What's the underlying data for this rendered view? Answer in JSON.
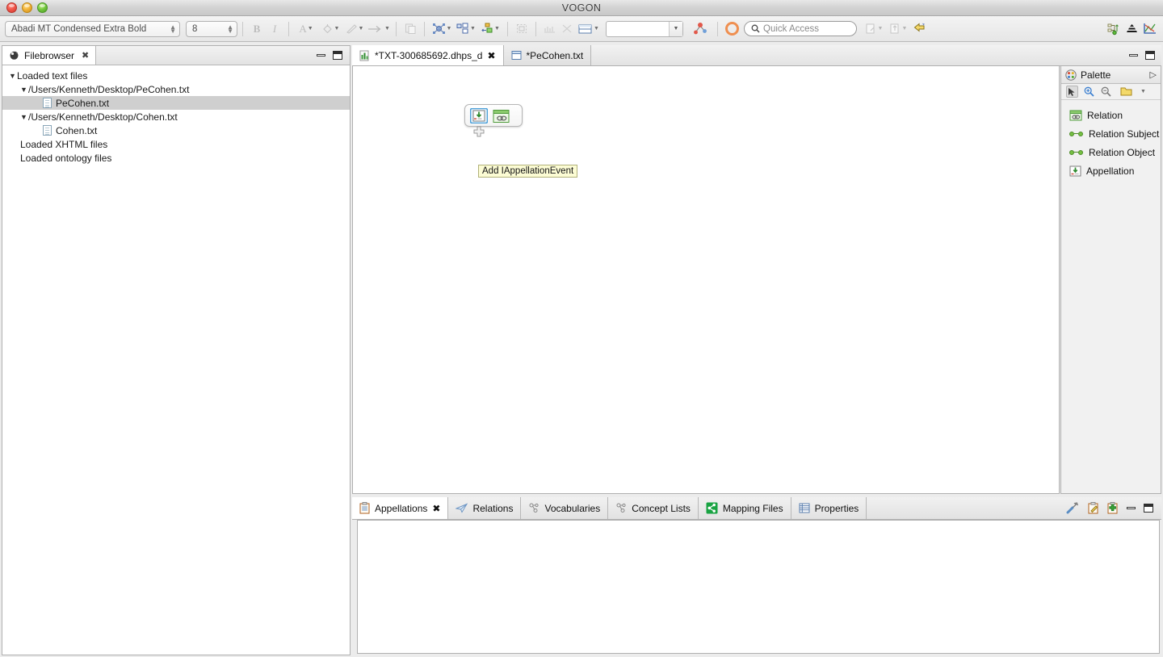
{
  "window": {
    "title": "VOGON",
    "traffic_lights": [
      "close-red",
      "minimize-amber",
      "maximize-green"
    ]
  },
  "toolbar": {
    "font_family_value": "Abadi MT Condensed Extra Bold",
    "font_size_value": "8",
    "bold_label": "B",
    "italic_label": "I",
    "font_color_label": "A",
    "fill_color_icon": "paint-bucket-icon",
    "line_color_icon": "pen-icon",
    "line_style_icon": "arrow-icon",
    "paste_icon": "paste-icon",
    "graph_icon": "graph-layout-icon",
    "align_icon": "align-objects-icon",
    "distribute_icon": "distribute-objects-icon",
    "marquee_icon": "marquee-select-icon",
    "ruler_icon": "ruler-icon",
    "cut_icon": "cut-icon",
    "zoom_value": "",
    "zoom_placeholder": "",
    "annotate_icon": "annotate-icon",
    "perspective_ring_icon": "perspective-icon",
    "quick_access_placeholder": "Quick Access",
    "quick_access_value": "",
    "open_perspective_icon": "open-perspective-icon",
    "switch_perspective_icon": "switch-perspective-icon",
    "cheatsheet_icon": "cheatsheet-icon",
    "right_icons": [
      "hierarchy-icon",
      "pyramid-icon",
      "chart-icon"
    ]
  },
  "filebrowser": {
    "tab_label": "Filebrowser",
    "close_icon": "close-icon",
    "minimize_icon": "minimize-icon",
    "maximize_icon": "maximize-icon",
    "tree": [
      {
        "label": "Loaded text files",
        "level": 0,
        "twisty": "expanded",
        "icon": null,
        "selected": false
      },
      {
        "label": "/Users/Kenneth/Desktop/PeCohen.txt",
        "level": 1,
        "twisty": "expanded",
        "icon": null,
        "selected": false
      },
      {
        "label": "PeCohen.txt",
        "level": 2,
        "twisty": "none",
        "icon": "file-icon",
        "selected": true
      },
      {
        "label": "/Users/Kenneth/Desktop/Cohen.txt",
        "level": 1,
        "twisty": "expanded",
        "icon": null,
        "selected": false
      },
      {
        "label": "Cohen.txt",
        "level": 2,
        "twisty": "none",
        "icon": "file-icon",
        "selected": false
      },
      {
        "label": "Loaded XHTML files",
        "level": 0,
        "twisty": "none",
        "icon": null,
        "selected": false
      },
      {
        "label": "Loaded ontology files",
        "level": 0,
        "twisty": "none",
        "icon": null,
        "selected": false
      }
    ]
  },
  "editor": {
    "tabs": [
      {
        "label": "*TXT-300685692.dhps_d",
        "icon": "diagram-icon",
        "active": true,
        "closable": true
      },
      {
        "label": "*PeCohen.txt",
        "icon": "text-editor-icon",
        "active": false,
        "closable": false
      }
    ],
    "minimize_icon": "minimize-icon",
    "maximize_icon": "maximize-icon",
    "canvas": {
      "node_toolbar": {
        "appellation_button_label": "Add IAppellationEvent",
        "buttons": [
          "appellation-icon",
          "relation-icon"
        ],
        "handle_icon": "plus-handle-icon"
      },
      "tooltip_text": "Add IAppellationEvent"
    }
  },
  "palette": {
    "title": "Palette",
    "collapse_icon": "chevron-right-icon",
    "tools": [
      {
        "name": "select-tool",
        "icon": "cursor-icon",
        "selected": true
      },
      {
        "name": "zoom-in-tool",
        "icon": "zoom-in-icon",
        "selected": false
      },
      {
        "name": "zoom-out-tool",
        "icon": "zoom-out-icon",
        "selected": false
      },
      {
        "name": "note-tool",
        "icon": "note-icon",
        "selected": false
      }
    ],
    "items": [
      {
        "label": "Relation",
        "icon": "relation-icon"
      },
      {
        "label": "Relation Subject",
        "icon": "link-icon"
      },
      {
        "label": "Relation Object",
        "icon": "link-icon"
      },
      {
        "label": "Appellation",
        "icon": "appellation-icon"
      }
    ]
  },
  "bottom_panel": {
    "tabs": [
      {
        "label": "Appellations",
        "icon": "clipboard-icon",
        "active": true,
        "closable": true
      },
      {
        "label": "Relations",
        "icon": "paper-plane-icon",
        "active": false,
        "closable": false
      },
      {
        "label": "Vocabularies",
        "icon": "nodes-icon",
        "active": false,
        "closable": false
      },
      {
        "label": "Concept Lists",
        "icon": "nodes-icon",
        "active": false,
        "closable": false
      },
      {
        "label": "Mapping Files",
        "icon": "share-icon",
        "active": false,
        "closable": false
      },
      {
        "label": "Properties",
        "icon": "properties-icon",
        "active": false,
        "closable": false
      }
    ],
    "tools": [
      {
        "name": "configure-button",
        "icon": "screwdriver-icon"
      },
      {
        "name": "edit-appellation-button",
        "icon": "clipboard-edit-icon"
      },
      {
        "name": "add-appellation-button",
        "icon": "clipboard-add-icon"
      },
      {
        "name": "minimize-button",
        "icon": "minimize-icon"
      },
      {
        "name": "maximize-button",
        "icon": "maximize-icon"
      }
    ],
    "content": ""
  },
  "colors": {
    "accent_orange": "#ef8f50",
    "green": "#4ea72e",
    "tooltip_bg": "#fcfcd4",
    "selection_gray": "#cfcfcf",
    "chrome_gray": "#ececec"
  }
}
